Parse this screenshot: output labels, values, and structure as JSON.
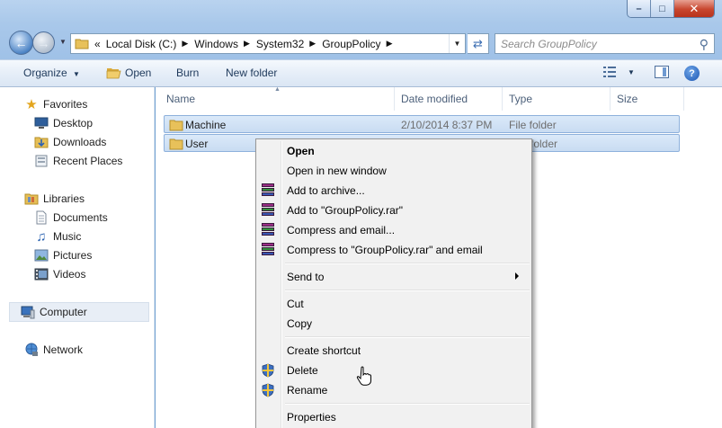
{
  "window": {
    "minimize": "–",
    "maximize": "□",
    "close": "✕"
  },
  "address": {
    "overflow": "«",
    "crumbs": [
      "Local Disk (C:)",
      "Windows",
      "System32",
      "GroupPolicy"
    ],
    "search_placeholder": "Search GroupPolicy"
  },
  "toolbar": {
    "organize": "Organize",
    "open": "Open",
    "burn": "Burn",
    "new_folder": "New folder"
  },
  "sidebar": {
    "favorites": "Favorites",
    "favorites_items": [
      "Desktop",
      "Downloads",
      "Recent Places"
    ],
    "libraries": "Libraries",
    "libraries_items": [
      "Documents",
      "Music",
      "Pictures",
      "Videos"
    ],
    "computer": "Computer",
    "network": "Network"
  },
  "columns": {
    "name": "Name",
    "date_modified": "Date modified",
    "type": "Type",
    "size": "Size"
  },
  "files": [
    {
      "name": "Machine",
      "date": "2/10/2014 8:37 PM",
      "type": "File folder"
    },
    {
      "name": "User",
      "date": "",
      "type": "folder"
    }
  ],
  "context_menu": {
    "open": "Open",
    "open_new_window": "Open in new window",
    "add_to_archive": "Add to archive...",
    "add_to_rar": "Add to \"GroupPolicy.rar\"",
    "compress_email": "Compress and email...",
    "compress_rar_email": "Compress to \"GroupPolicy.rar\" and email",
    "send_to": "Send to",
    "cut": "Cut",
    "copy": "Copy",
    "create_shortcut": "Create shortcut",
    "delete": "Delete",
    "rename": "Rename",
    "properties": "Properties"
  },
  "colors": {
    "selection": "#cfe0f5",
    "accent": "#1e395b"
  }
}
